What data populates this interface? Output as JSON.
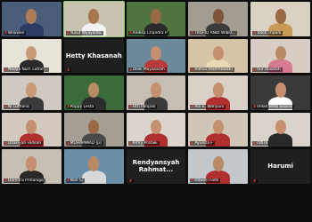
{
  "participants": [
    {
      "name": "Wilowen",
      "bg": "#4a5d7a",
      "skin": "#b07b58",
      "wear": "#2d3c63",
      "muted": true
    },
    {
      "name": "Yusuf Wijayanto",
      "bg": "#c7c2b0",
      "skin": "#a8754c",
      "wear": "#f2f2f2",
      "muted": true,
      "active": true
    },
    {
      "name": "Andika Chandra P",
      "bg": "#4f7440",
      "skin": "#9a6a48",
      "wear": "#2a2a2a",
      "muted": true
    },
    {
      "name": "TAUFIQ ANDI WIBO...",
      "bg": "#a39d91",
      "skin": "#7d5638",
      "wear": "#3a3a3a",
      "muted": true
    },
    {
      "name": "Tolok Tripadi",
      "bg": "#d9d2c3",
      "skin": "#9a6a46",
      "wear": "#c79b56",
      "muted": true
    },
    {
      "name": "Nadya Nurf. Lathif...",
      "bg": "#e8e3d8",
      "skin": "#c89a7a",
      "wear": "#2a2a2a",
      "muted": true
    },
    {
      "name": "Hetty Khasanah",
      "bg": "#1f1f1f",
      "nameOnly": true,
      "muted": true
    },
    {
      "name": "Dewi Mayasaroh",
      "bg": "#6d8a9a",
      "skin": "#c49070",
      "wear": "#b83a3a",
      "muted": true
    },
    {
      "name": "Rahsa (Rahmawati)",
      "bg": "#d6c4a6",
      "skin": "#c49070",
      "wear": "#e8d9b5",
      "muted": true
    },
    {
      "name": "nur masitoh",
      "bg": "#d8ccc4",
      "skin": "#b88a66",
      "wear": "#d67a92",
      "muted": true
    },
    {
      "name": "Ni Lutfiana",
      "bg": "#cfc9c1",
      "skin": "#c89a7a",
      "wear": "#3a3a3a",
      "muted": true
    },
    {
      "name": "Poppy Lesta",
      "bg": "#3a6b3a",
      "skin": "#b88a66",
      "wear": "#2c2c2c",
      "muted": true
    },
    {
      "name": "Fitri Pahjadi",
      "bg": "#c6beb5",
      "skin": "#c49070",
      "wear": "#3a3a3a",
      "muted": true
    },
    {
      "name": "Ani S. Wahyuni",
      "bg": "#d9d0c8",
      "skin": "#c49070",
      "wear": "#b03030",
      "muted": true
    },
    {
      "name": "Indah Beta Sitarisi",
      "bg": "#3a3a3a",
      "skin": "#c49070",
      "wear": "#ffffff",
      "muted": true
    },
    {
      "name": "Dzakiyah Fadilah",
      "bg": "#d4c9be",
      "skin": "#c49070",
      "wear": "#b03030",
      "muted": true
    },
    {
      "name": "MUHAMMAD (p)",
      "bg": "#a59e94",
      "skin": "#9a6a46",
      "wear": "#4a4a4a",
      "muted": true
    },
    {
      "name": "Amry Pratiwi",
      "bg": "#dad4cc",
      "skin": "#c49070",
      "wear": "#b03030",
      "muted": true
    },
    {
      "name": "Ayunita F",
      "bg": "#d0c6b8",
      "skin": "#c49070",
      "wear": "#b03030",
      "muted": true
    },
    {
      "name": "rafisa",
      "bg": "#d9d3cb",
      "skin": "#c49070",
      "wear": "#2a2a2a",
      "muted": true
    },
    {
      "name": "Damitra Prihaniga",
      "bg": "#c8bfb4",
      "skin": "#c49070",
      "wear": "#2a2a2a",
      "muted": true
    },
    {
      "name": "Nan S.",
      "bg": "#6b8fa8",
      "skin": "#b88a66",
      "wear": "#d8d8d8",
      "muted": true
    },
    {
      "name": "Rendyansyah Rahmat...",
      "bg": "#1f1f1f",
      "nameOnly": true,
      "muted": true
    },
    {
      "name": "Hawari Fadli",
      "bg": "#c2c8cc",
      "skin": "#b88a66",
      "wear": "#b03030",
      "muted": true
    },
    {
      "name": "Harumi",
      "bg": "#1f1f1f",
      "nameOnly": true,
      "muted": true
    }
  ],
  "tiles_shown_name_large": [
    "Hetty Khasanah",
    "Harumi"
  ]
}
